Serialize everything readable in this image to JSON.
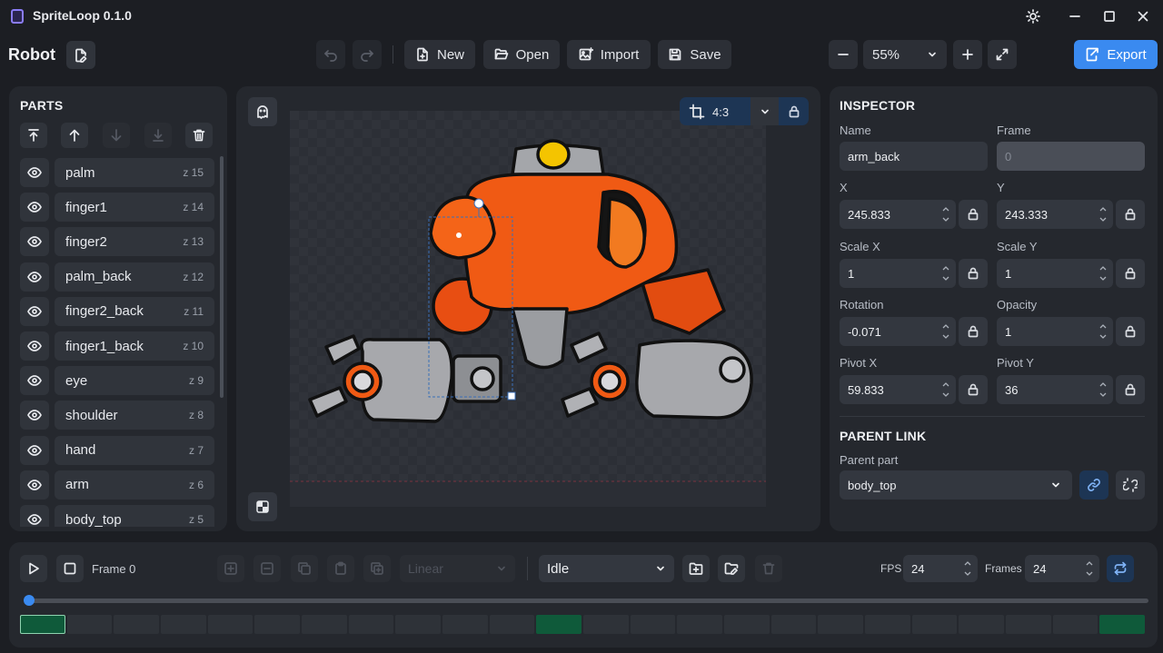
{
  "app": {
    "title": "SpriteLoop 0.1.0"
  },
  "toolbar": {
    "project_name": "Robot",
    "new_label": "New",
    "open_label": "Open",
    "import_label": "Import",
    "save_label": "Save",
    "zoom_value": "55%",
    "export_label": "Export"
  },
  "parts": {
    "title": "PARTS",
    "items": [
      {
        "name": "palm",
        "z": "z 15"
      },
      {
        "name": "finger1",
        "z": "z 14"
      },
      {
        "name": "finger2",
        "z": "z 13"
      },
      {
        "name": "palm_back",
        "z": "z 12"
      },
      {
        "name": "finger2_back",
        "z": "z 11"
      },
      {
        "name": "finger1_back",
        "z": "z 10"
      },
      {
        "name": "eye",
        "z": "z 9"
      },
      {
        "name": "shoulder",
        "z": "z 8"
      },
      {
        "name": "hand",
        "z": "z 7"
      },
      {
        "name": "arm",
        "z": "z 6"
      },
      {
        "name": "body_top",
        "z": "z 5"
      }
    ]
  },
  "canvas": {
    "aspect_label": "4:3"
  },
  "inspector": {
    "title": "INSPECTOR",
    "name_label": "Name",
    "name_value": "arm_back",
    "frame_label": "Frame",
    "frame_value": "0",
    "x_label": "X",
    "x_value": "245.833",
    "y_label": "Y",
    "y_value": "243.333",
    "scalex_label": "Scale X",
    "scalex_value": "1",
    "scaley_label": "Scale Y",
    "scaley_value": "1",
    "rotation_label": "Rotation",
    "rotation_value": "-0.071",
    "opacity_label": "Opacity",
    "opacity_value": "1",
    "pivotx_label": "Pivot X",
    "pivotx_value": "59.833",
    "pivoty_label": "Pivot Y",
    "pivoty_value": "36",
    "parent_title": "PARENT LINK",
    "parent_label": "Parent part",
    "parent_value": "body_top"
  },
  "timeline": {
    "frame_label": "Frame 0",
    "easing_value": "Linear",
    "animation_value": "Idle",
    "fps_label": "FPS",
    "fps_value": "24",
    "frames_label": "Frames",
    "frames_value": "24",
    "playhead_fraction": 0,
    "keyframes": [
      0,
      11,
      23
    ],
    "selected_frame": 0,
    "frame_count": 24
  },
  "colors": {
    "accent": "#3a8af0",
    "keyframe": "#0f5a3a",
    "robot_orange": "#f05a14",
    "robot_gray": "#a7a8ac"
  }
}
